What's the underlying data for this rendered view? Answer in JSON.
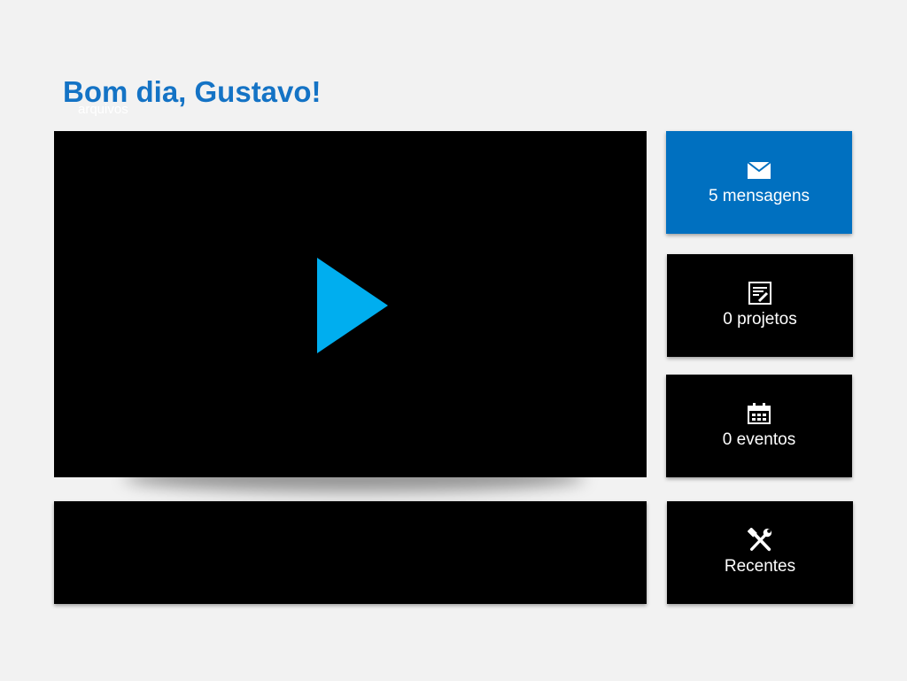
{
  "header": {
    "greeting": "Bom dia, Gustavo!",
    "subtitle": "arquivos"
  },
  "tiles": [
    {
      "label": "5 mensagens",
      "icon": "envelope-icon"
    },
    {
      "label": "0 projetos",
      "icon": "document-edit-icon"
    },
    {
      "label": "0 eventos",
      "icon": "calendar-icon"
    },
    {
      "label": "Recentes",
      "icon": "tools-icon"
    }
  ],
  "colors": {
    "accent": "#1473c5",
    "tile_active": "#0070c0",
    "play": "#00aeef",
    "background": "#f2f2f2",
    "panel": "#000000"
  }
}
